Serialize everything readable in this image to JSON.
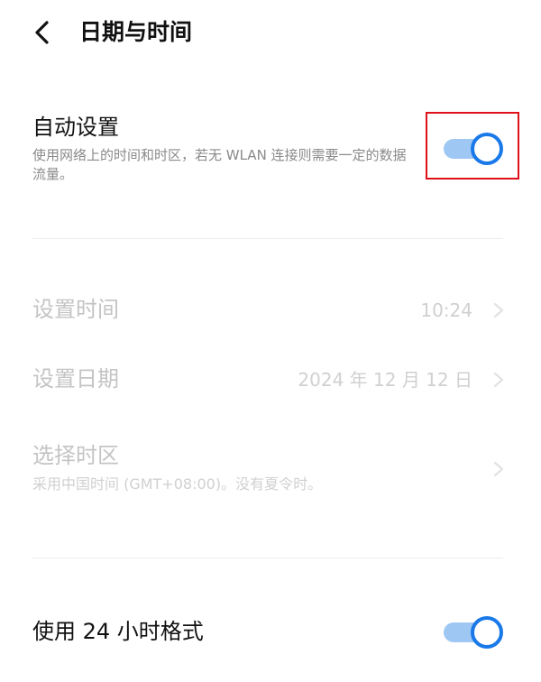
{
  "header": {
    "title": "日期与时间",
    "back_icon": "chevron-left-icon"
  },
  "auto_setting": {
    "title": "自动设置",
    "description": "使用网络上的时间和时区，若无 WLAN 连接则需要一定的数据流量。",
    "toggle_on": true
  },
  "set_time": {
    "label": "设置时间",
    "value": "10:24"
  },
  "set_date": {
    "label": "设置日期",
    "value": "2024 年 12 月 12 日"
  },
  "time_zone": {
    "label": "选择时区",
    "subtitle": "采用中国时间 (GMT+08:00)。没有夏令时。"
  },
  "format_24h": {
    "label": "使用 24 小时格式",
    "toggle_on": true
  },
  "colors": {
    "accent": "#1a79e8",
    "track_on": "#9ec7f4",
    "highlight": "#e0101a",
    "disabled_text": "#c4c4c4"
  }
}
